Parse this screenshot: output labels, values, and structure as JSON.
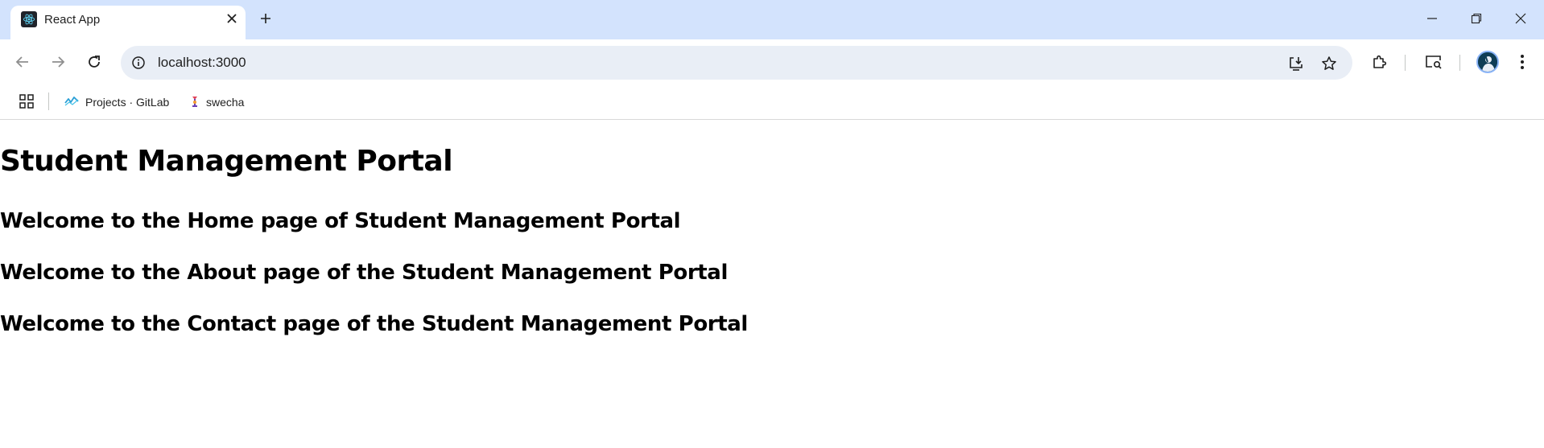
{
  "browser": {
    "tab": {
      "title": "React App",
      "favicon": "react-logo-icon"
    },
    "new_tab_icon": "plus-icon",
    "window_controls": [
      "minimize-icon",
      "restore-icon",
      "close-icon"
    ],
    "toolbar": {
      "back_icon": "arrow-left-icon",
      "forward_icon": "arrow-right-icon",
      "reload_icon": "reload-icon",
      "url": "localhost:3000",
      "site_info_icon": "info-icon",
      "install_icon": "install-app-icon",
      "bookmark_icon": "star-icon",
      "extensions_icon": "puzzle-icon",
      "search_tabs_icon": "tab-search-icon",
      "menu_icon": "kebab-menu-icon"
    },
    "bookmarks": [
      {
        "label": "Projects · GitLab",
        "icon": "gitlab-icon"
      },
      {
        "label": "swecha",
        "icon": "swecha-icon"
      }
    ]
  },
  "page": {
    "title": "Student Management Portal",
    "sections": [
      "Welcome to the Home page of Student Management Portal",
      "Welcome to the About page of the Student Management Portal",
      "Welcome to the Contact page of the Student Management Portal"
    ]
  }
}
